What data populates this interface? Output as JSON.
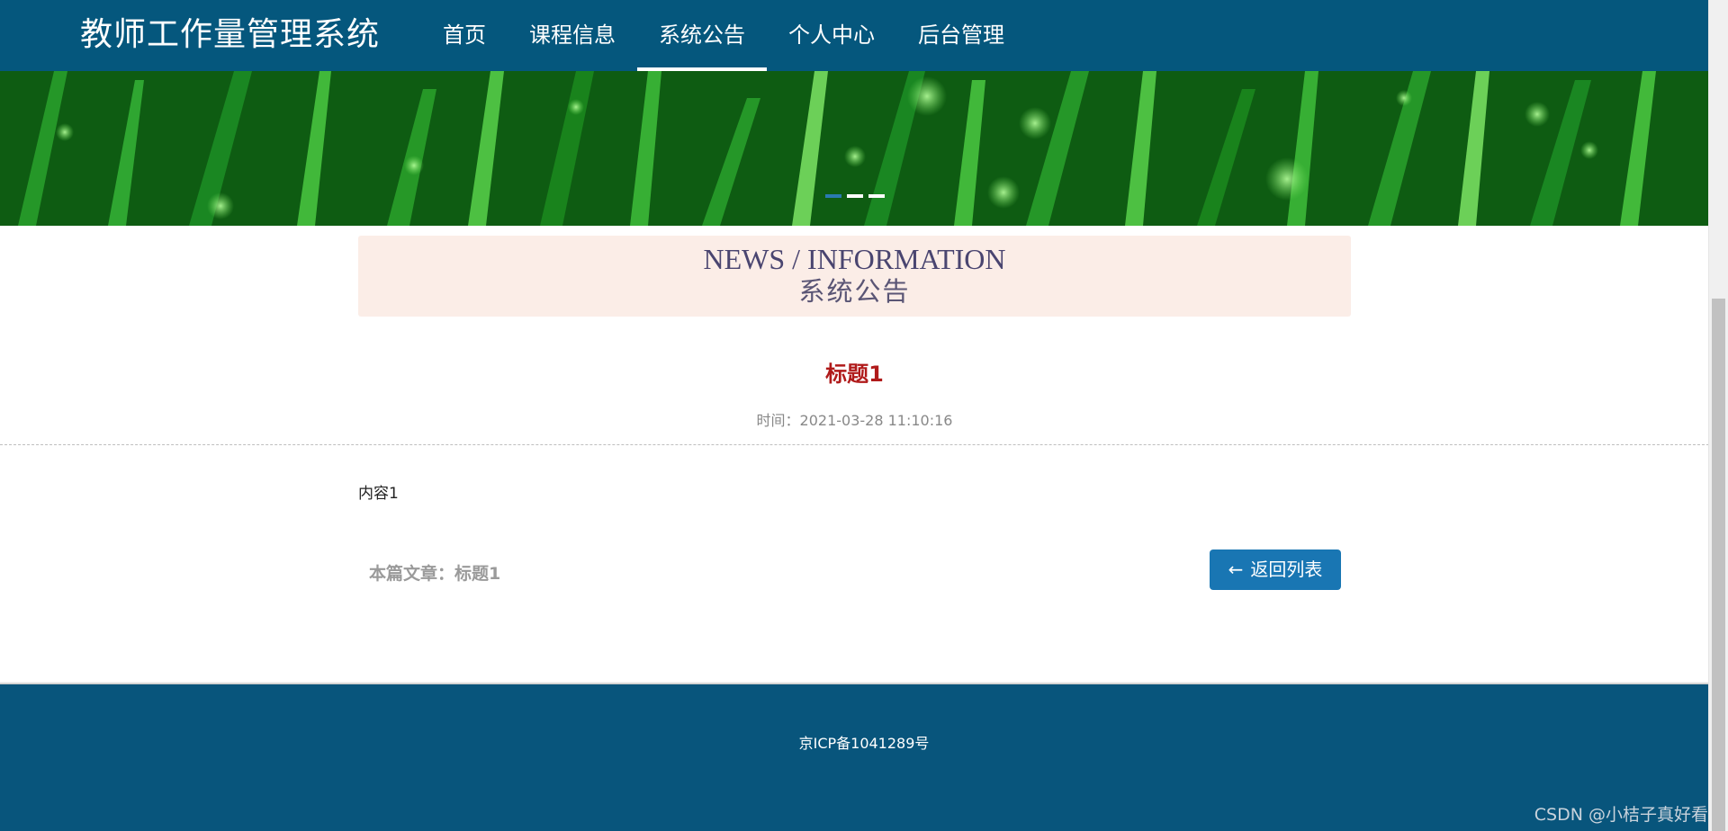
{
  "header": {
    "brand": "教师工作量管理系统",
    "nav": [
      {
        "label": "首页",
        "active": false
      },
      {
        "label": "课程信息",
        "active": false
      },
      {
        "label": "系统公告",
        "active": true
      },
      {
        "label": "个人中心",
        "active": false
      },
      {
        "label": "后台管理",
        "active": false
      }
    ],
    "colors": {
      "nav_bg": "#05577d",
      "active_underline": "#ffffff"
    }
  },
  "banner": {
    "carousel_dots": 3,
    "active_dot": 0
  },
  "section": {
    "english_title": "NEWS / INFORMATION",
    "chinese_title": "系统公告"
  },
  "article": {
    "title": "标题1",
    "time": "时间：2021-03-28 11:10:16",
    "content": "内容1",
    "current_label": "本篇文章：标题1",
    "back_button": "返回列表",
    "back_icon": "arrow-left-icon"
  },
  "footer": {
    "icp": "京ICP备1041289号",
    "watermark": "CSDN @小桔子真好看"
  }
}
